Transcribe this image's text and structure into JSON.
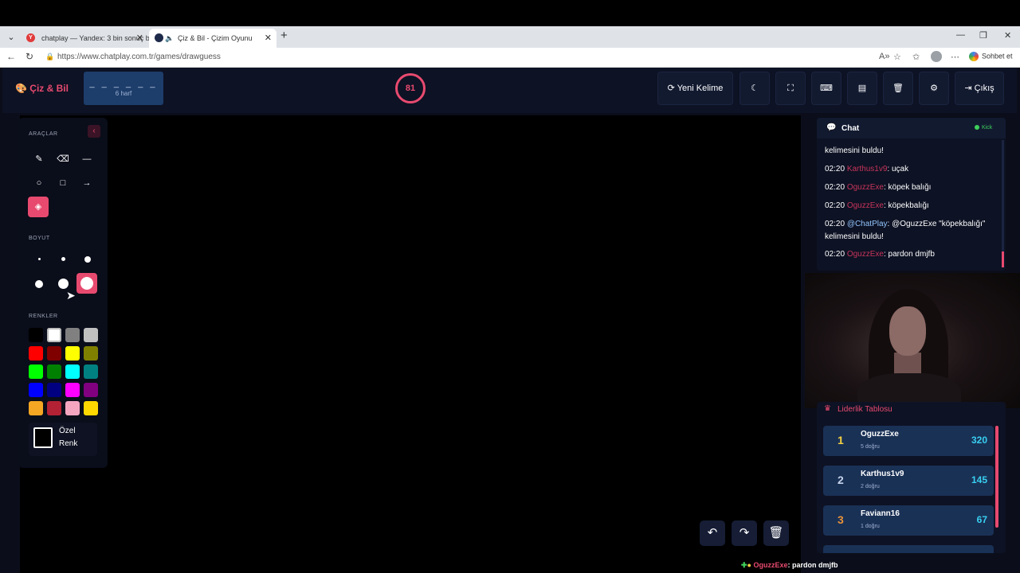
{
  "browser": {
    "tabs": [
      {
        "title": "chatplay — Yandex: 3 bin sonuç b",
        "favicon": "yandex-icon"
      },
      {
        "title": "Çiz & Bil - Çizim Oyunu",
        "favicon": "game-icon",
        "active": true
      }
    ],
    "url": "https://www.chatplay.com.tr/games/drawguess",
    "sohbet_label": "Sohbet et"
  },
  "header": {
    "logo": "Çiz & Bil",
    "word_mask": "_ _ _ _ _ _",
    "word_len_label": "6 harf",
    "timer": "81",
    "new_word_label": "Yeni Kelime",
    "exit_label": "Çıkış"
  },
  "tools": {
    "section_tools": "ARAÇLAR",
    "section_size": "BOYUT",
    "section_colors": "RENKLER",
    "custom_color_line1": "Özel",
    "custom_color_line2": "Renk",
    "colors": [
      "#000000",
      "#ffffff",
      "#808080",
      "#c0c0c0",
      "#ff0000",
      "#800000",
      "#ffff00",
      "#808000",
      "#00ff00",
      "#008000",
      "#00ffff",
      "#008080",
      "#0000ff",
      "#000080",
      "#ff00ff",
      "#800080",
      "#f5a623",
      "#b22234",
      "#f4a6c0",
      "#ffd700"
    ]
  },
  "chat": {
    "title": "Chat",
    "platform": "Kick",
    "messages": [
      {
        "time": "",
        "user": "",
        "text": "kelimesini buldu!"
      },
      {
        "time": "02:20",
        "user": "Karthus1v9",
        "text": ": uçak"
      },
      {
        "time": "02:20",
        "user": "OguzzExe",
        "text": ": köpek balığı"
      },
      {
        "time": "02:20",
        "user": "OguzzExe",
        "text": ": köpekbalığı"
      },
      {
        "time": "02:20",
        "user": "@ChatPlay",
        "text": ": @OguzzExe \"köpekbalığı\" kelimesini buldu!"
      },
      {
        "time": "02:20",
        "user": "OguzzExe",
        "text": ": pardon dmjfb"
      }
    ]
  },
  "leaderboard": {
    "title": "Liderlik Tablosu",
    "rows": [
      {
        "rank": "1",
        "name": "OguzzExe",
        "sub": "5 doğru",
        "score": "320",
        "rank_color": "#f5d142"
      },
      {
        "rank": "2",
        "name": "Karthus1v9",
        "sub": "2 doğru",
        "score": "145",
        "rank_color": "#c6d4ec"
      },
      {
        "rank": "3",
        "name": "Faviann16",
        "sub": "1 doğru",
        "score": "67",
        "rank_color": "#e8923a"
      }
    ]
  },
  "ticker": {
    "user": "OguzzExe",
    "text": ": pardon dmjfb"
  }
}
